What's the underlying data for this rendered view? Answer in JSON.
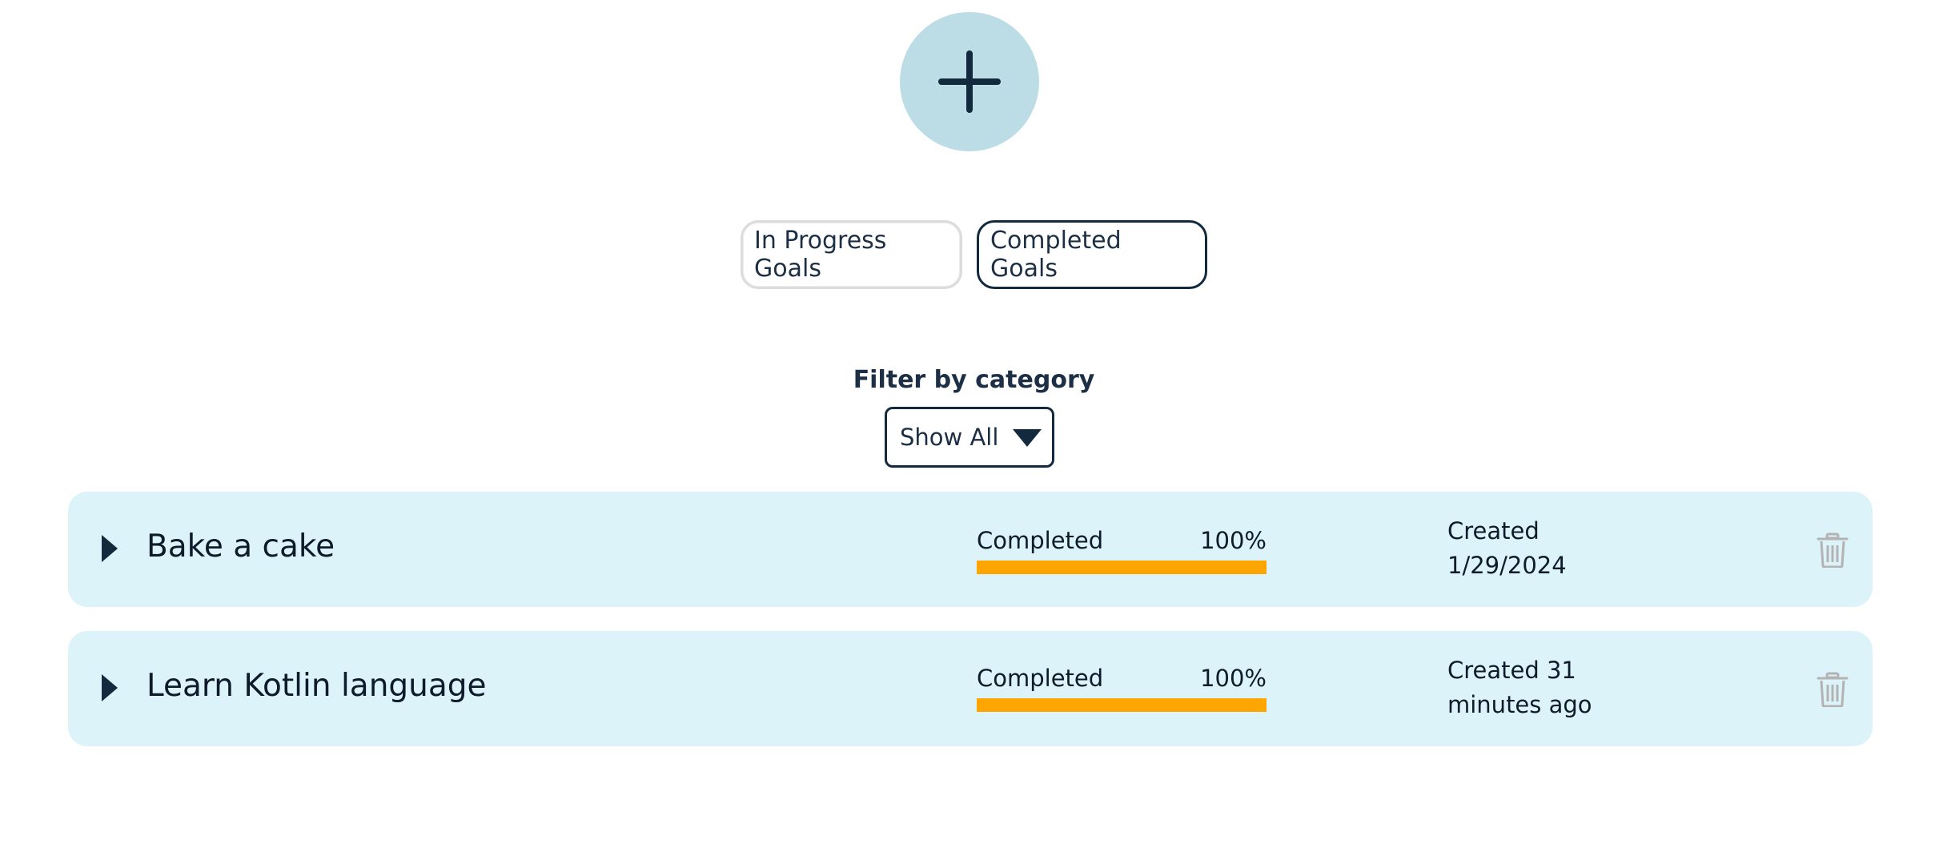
{
  "add_button": {
    "icon": "plus-icon"
  },
  "tabs": [
    {
      "label": "In Progress Goals",
      "active": false
    },
    {
      "label": "Completed Goals",
      "active": true
    }
  ],
  "filter": {
    "label": "Filter by category",
    "selected": "Show All"
  },
  "goals": [
    {
      "title": "Bake a cake",
      "status": "Completed",
      "progress_text": "100%",
      "progress": 1.0,
      "created": "Created 1/29/2024"
    },
    {
      "title": "Learn Kotlin language",
      "status": "Completed",
      "progress_text": "100%",
      "progress": 1.0,
      "created": "Created 31 minutes ago"
    }
  ],
  "colors": {
    "accent": "#13293d",
    "add_button_bg": "#bcdde6",
    "card_bg": "#ddf3fa",
    "progress_fill": "#ffa500",
    "trash_icon": "#b3b3b3"
  }
}
